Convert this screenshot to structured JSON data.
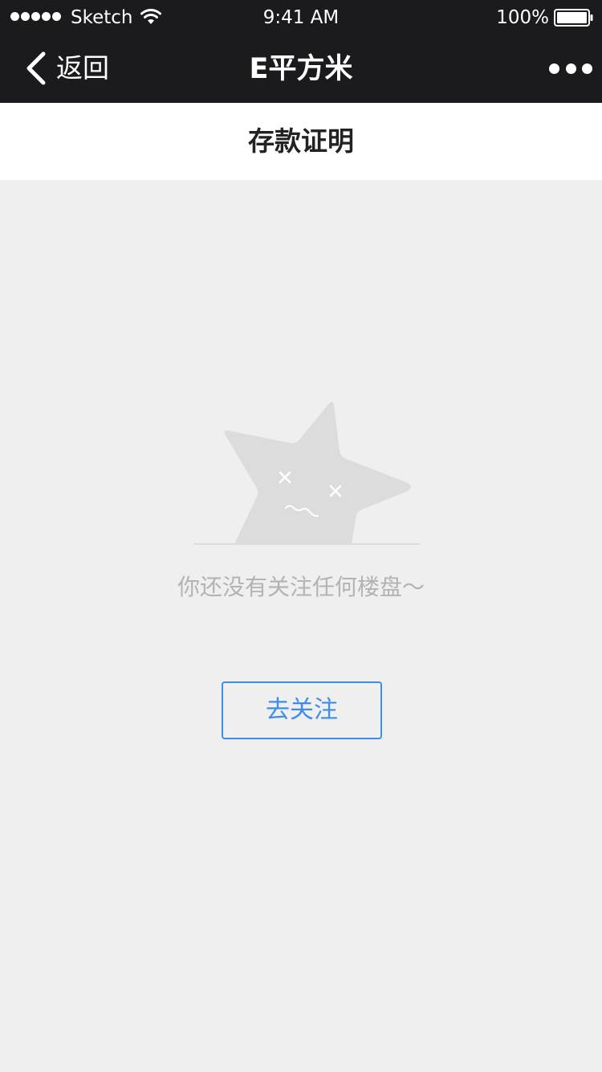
{
  "status_bar": {
    "carrier": "Sketch",
    "time": "9:41 AM",
    "battery": "100%"
  },
  "nav": {
    "back_label": "返回",
    "title": "E平方米",
    "back_icon": "chevron-left-icon",
    "more_icon": "more-dots-icon"
  },
  "page": {
    "title": "存款证明"
  },
  "empty_state": {
    "illustration": "dizzy-star-icon",
    "message": "你还没有关注任何楼盘～",
    "action_label": "去关注"
  },
  "colors": {
    "nav_background": "#1b1b1d",
    "page_background": "#efefef",
    "accent": "#3d8ee8",
    "muted_text": "#b3b3b3"
  }
}
